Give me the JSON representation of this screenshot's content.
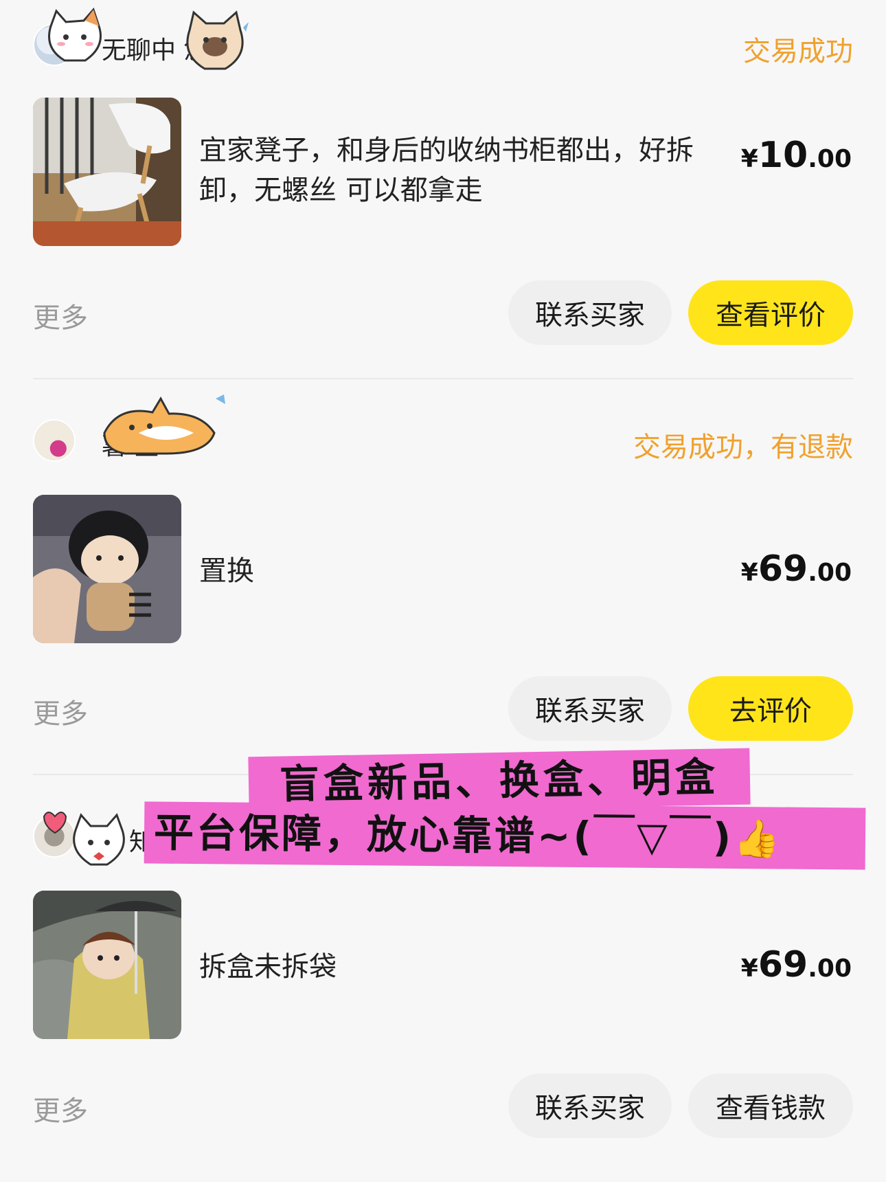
{
  "orders": [
    {
      "buyer_name": "无聊中  悠闲",
      "status": "交易成功",
      "title": "宜家凳子，和身后的收纳书柜都出，好拆卸，无螺丝 可以都拿走",
      "price_symbol": "¥",
      "price_int": "10",
      "price_dec": ".00",
      "more": "更多",
      "btn_contact": "联系买家",
      "btn_primary": "查看评价"
    },
    {
      "buyer_name": "薯      堂",
      "status": "交易成功，有退款",
      "title": "置换",
      "price_symbol": "¥",
      "price_int": "69",
      "price_dec": ".00",
      "more": "更多",
      "btn_contact": "联系买家",
      "btn_primary": "去评价"
    },
    {
      "buyer_name": "知",
      "status": "",
      "title": "拆盒未拆袋",
      "price_symbol": "¥",
      "price_int": "69",
      "price_dec": ".00",
      "more": "更多",
      "btn_contact": "联系买家",
      "btn_primary": "查看钱款"
    }
  ],
  "promo": {
    "line1": "盲盒新品、换盒、明盒",
    "line2": "平台保障，放心靠谱~(￣▽￣)",
    "emoji": "👍"
  },
  "colors": {
    "status": "#f0a12c",
    "primary_button": "#ffe41a",
    "secondary_button": "#efefef",
    "promo_bg": "#f06ad0"
  }
}
